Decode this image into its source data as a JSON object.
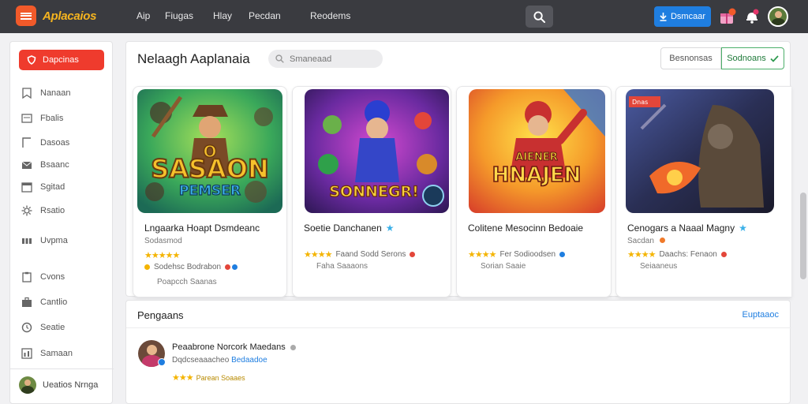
{
  "topbar": {
    "logo_text": "Aplacaios",
    "nav": [
      "Aip",
      "Fiugas",
      "Hlay",
      "Pecdan",
      "Reodems"
    ],
    "download_label": "Dsmcaar",
    "icons": [
      "search-icon",
      "download-icon",
      "gift-icon",
      "bell-icon",
      "avatar"
    ]
  },
  "sidebar": {
    "cta_label": "Dapcinas",
    "items": [
      {
        "label": "Nanaan",
        "icon": "bookmark-icon"
      },
      {
        "label": "Fbalis",
        "icon": "page-icon"
      },
      {
        "label": "Dasoas",
        "icon": "frame-icon"
      },
      {
        "label": "Bsaanc",
        "icon": "mail-icon"
      },
      {
        "label": "Sgitad",
        "icon": "calendar-icon"
      },
      {
        "label": "Rsatio",
        "icon": "gear-icon"
      },
      {
        "label": "Uvpma",
        "icon": "grid-icon"
      },
      {
        "label": "Cvons",
        "icon": "clipboard-icon"
      },
      {
        "label": "Cantlio",
        "icon": "briefcase-icon"
      },
      {
        "label": "Seatie",
        "icon": "clock-icon"
      },
      {
        "label": "Samaan",
        "icon": "chart-icon"
      }
    ],
    "user_label": "Ueatios Nrnga"
  },
  "main": {
    "title": "Nelaagh Aaplanaia",
    "search_placeholder": "Smaneaad",
    "segments": [
      "Besnonsas",
      "Sodnoans"
    ],
    "cards": [
      {
        "art_title": "SASAON",
        "art_subtitle": "PEMSER",
        "art_extra": "O",
        "name": "Lngaarka Hoapt Dsmdeanc",
        "publisher": "Sodasmod",
        "rating_stars": "★★★★★",
        "meta": "",
        "meta2": "Sodehsc Bodrabon",
        "sub": "Poapcch Saanas"
      },
      {
        "art_title": "SONNEGR!",
        "art_subtitle": "",
        "art_extra": "",
        "name": "Soetie Danchanen",
        "publisher": "",
        "rating_stars": "★★★★",
        "meta": "Faand Sodd Serons",
        "meta2": "",
        "sub": "Faha Saaaons"
      },
      {
        "art_title": "HNAJEN",
        "art_subtitle": "AIENER",
        "art_extra": "",
        "name": "Colitene Mesocinn Bedoaie",
        "publisher": "",
        "rating_stars": "★★★★",
        "meta": "Fer Sodioodsen",
        "meta2": "",
        "sub": "Sorian Saaie"
      },
      {
        "art_title": "",
        "art_subtitle": "",
        "art_extra": "",
        "art_badge": "Dnas",
        "name": "Cenogars a Naaal Magny",
        "publisher": "Sacdan",
        "rating_stars": "★★★★",
        "meta": "Daachs: Fenaon",
        "meta2": "",
        "sub": "Seiaaneus"
      }
    ]
  },
  "reviews": {
    "title": "Pengaans",
    "link": "Euptaaoc",
    "item": {
      "name": "Peaabrone Norcork Maedans",
      "sub_prefix": "Dqdcseaaacheo",
      "sub_highlight": "Bedaadoe",
      "rating_stars": "★★★",
      "rating_text": "Parean Soaaes"
    }
  },
  "colors": {
    "topbar": "#3a3b40",
    "accent_red": "#ef3b2d",
    "accent_blue": "#1f7ee0",
    "accent_green": "#4caf6a",
    "star": "#f4b400"
  }
}
